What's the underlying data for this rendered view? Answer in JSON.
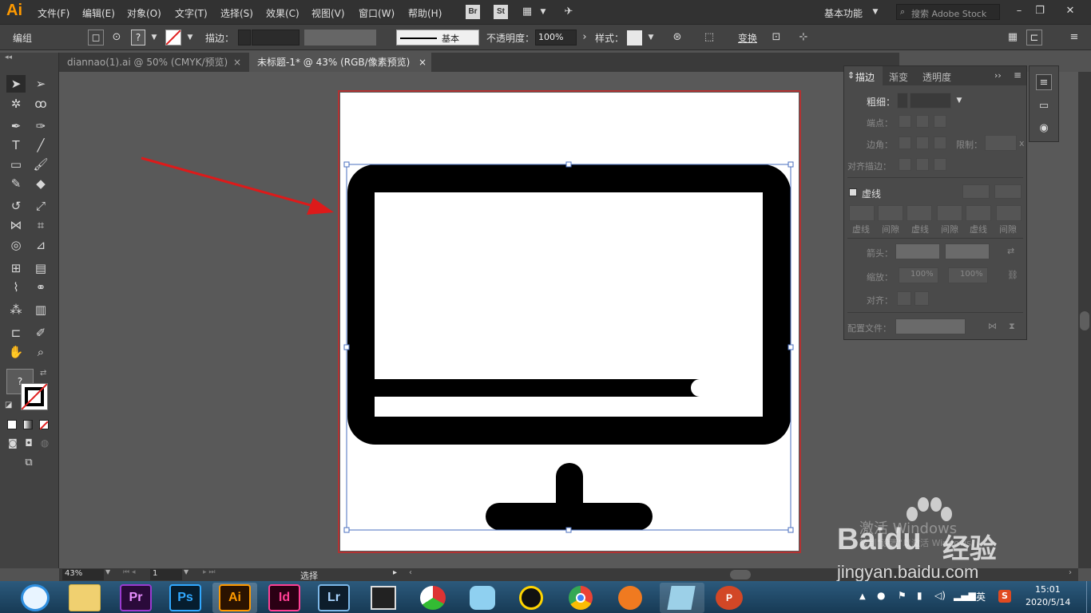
{
  "app": {
    "logo": "Ai"
  },
  "menu": [
    "文件(F)",
    "编辑(E)",
    "对象(O)",
    "文字(T)",
    "选择(S)",
    "效果(C)",
    "视图(V)",
    "窗口(W)",
    "帮助(H)"
  ],
  "menubar_right": {
    "br": "Br",
    "st": "St",
    "workspace": "基本功能",
    "search_placeholder": "搜索 Adobe Stock"
  },
  "control": {
    "mode": "编组",
    "stroke_label": "描边：",
    "stroke_style": "基本",
    "opacity_label": "不透明度：",
    "opacity_value": "100%",
    "style_label": "样式：",
    "transform": "变换",
    "fill_q": "?"
  },
  "tabs": [
    {
      "label": "diannao(1).ai @ 50% (CMYK/预览)",
      "close": "×"
    },
    {
      "label": "未标题-1* @ 43% (RGB/像素预览)",
      "close": "×"
    }
  ],
  "stroke_panel": {
    "tabs": [
      "描边",
      "渐变",
      "透明度"
    ],
    "weight_label": "粗细：",
    "cap_label": "端点：",
    "corner_label": "边角：",
    "limit_label": "限制：",
    "limit_unit": "x",
    "align_label": "对齐描边：",
    "dashed_label": "虚线",
    "dash_cols": [
      "虚线",
      "间隙",
      "虚线",
      "间隙",
      "虚线",
      "间隙"
    ],
    "arrow_label": "箭头：",
    "scale_label": "缩放：",
    "scale1": "100%",
    "scale2": "100%",
    "align2_label": "对齐：",
    "profile_label": "配置文件："
  },
  "status": {
    "zoom": "43%",
    "page": "1",
    "tool": "选择"
  },
  "watermark": {
    "activate": "激活 Windows",
    "activate_sub": "转到\"设置\"以激活 Windows。",
    "baidu_brand": "Baidu",
    "baidu_cn": "经验",
    "url": "jingyan.baidu.com"
  },
  "taskbar": {
    "apps": [
      "Pr",
      "Ps",
      "Ai",
      "Id",
      "Lr"
    ],
    "time": "15:01",
    "date": "2020/5/14",
    "ime": "英"
  },
  "colors": {
    "accent": "#ff9a00",
    "arrow": "#dd1a1a",
    "selection": "#4a6fbf"
  }
}
